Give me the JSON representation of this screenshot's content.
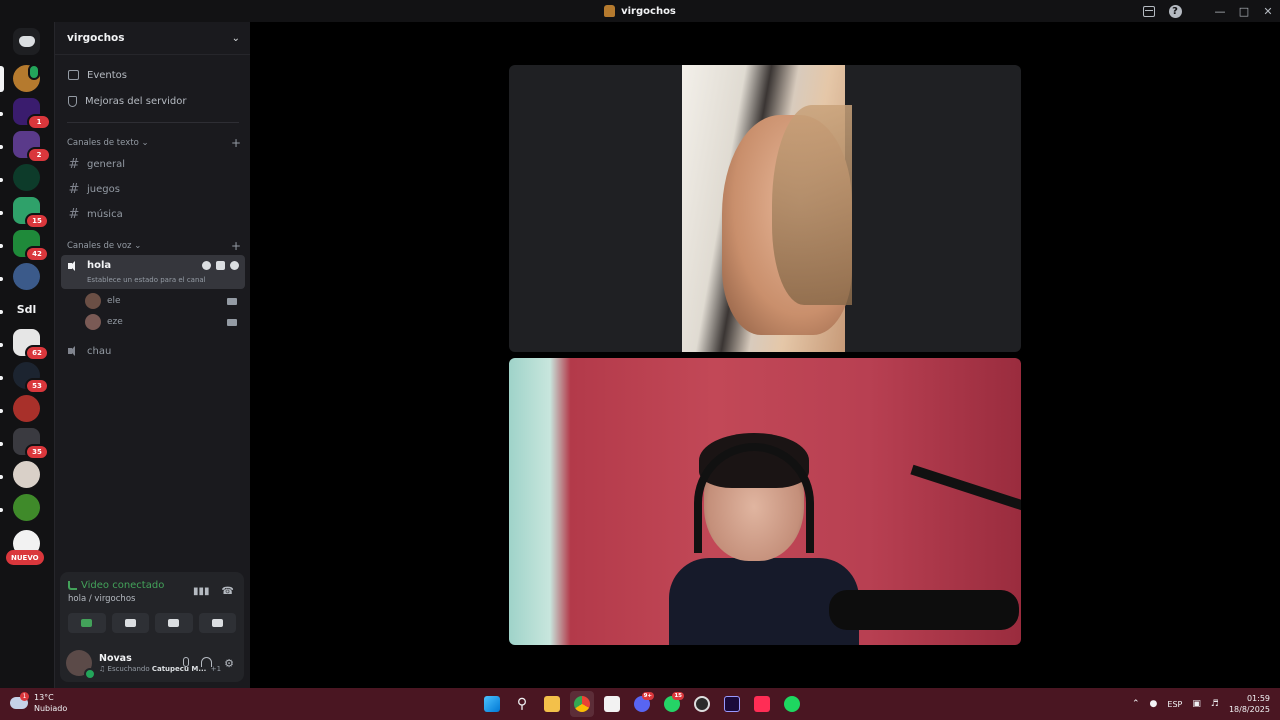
{
  "window": {
    "title": "virgochos"
  },
  "rail": {
    "badges": [
      "1",
      "2",
      "15",
      "42",
      "62",
      "53",
      "35"
    ],
    "text_server": "Sdl",
    "new_label": "NUEVO"
  },
  "sidebar": {
    "guild_name": "virgochos",
    "nav": [
      {
        "label": "Eventos"
      },
      {
        "label": "Mejoras del servidor"
      }
    ],
    "text_category": "Canales de texto",
    "text_channels": [
      "general",
      "juegos",
      "música"
    ],
    "voice_category": "Canales de voz",
    "active_voice_channel": {
      "name": "hola",
      "status_placeholder": "Establece un estado para el canal"
    },
    "voice_users": [
      "ele",
      "eze"
    ],
    "other_voice_channel": "chau"
  },
  "voice_panel": {
    "title": "Video conectado",
    "subtitle": "hola / virgochos"
  },
  "user": {
    "name": "Novas",
    "activity_prefix": "Escuchando",
    "activity_target": "Catupecu M...",
    "extra": "+1"
  },
  "taskbar": {
    "weather_temp": "13°C",
    "weather_desc": "Nubiado",
    "weather_badge": "1",
    "discord_badge": "9+",
    "whatsapp_badge": "15",
    "language": "ESP",
    "time": "01:59",
    "date": "18/8/2025"
  },
  "colors": {
    "connected_green": "#43a25a",
    "badge_red": "#da373c",
    "taskbar_bg": "#4a1622"
  }
}
